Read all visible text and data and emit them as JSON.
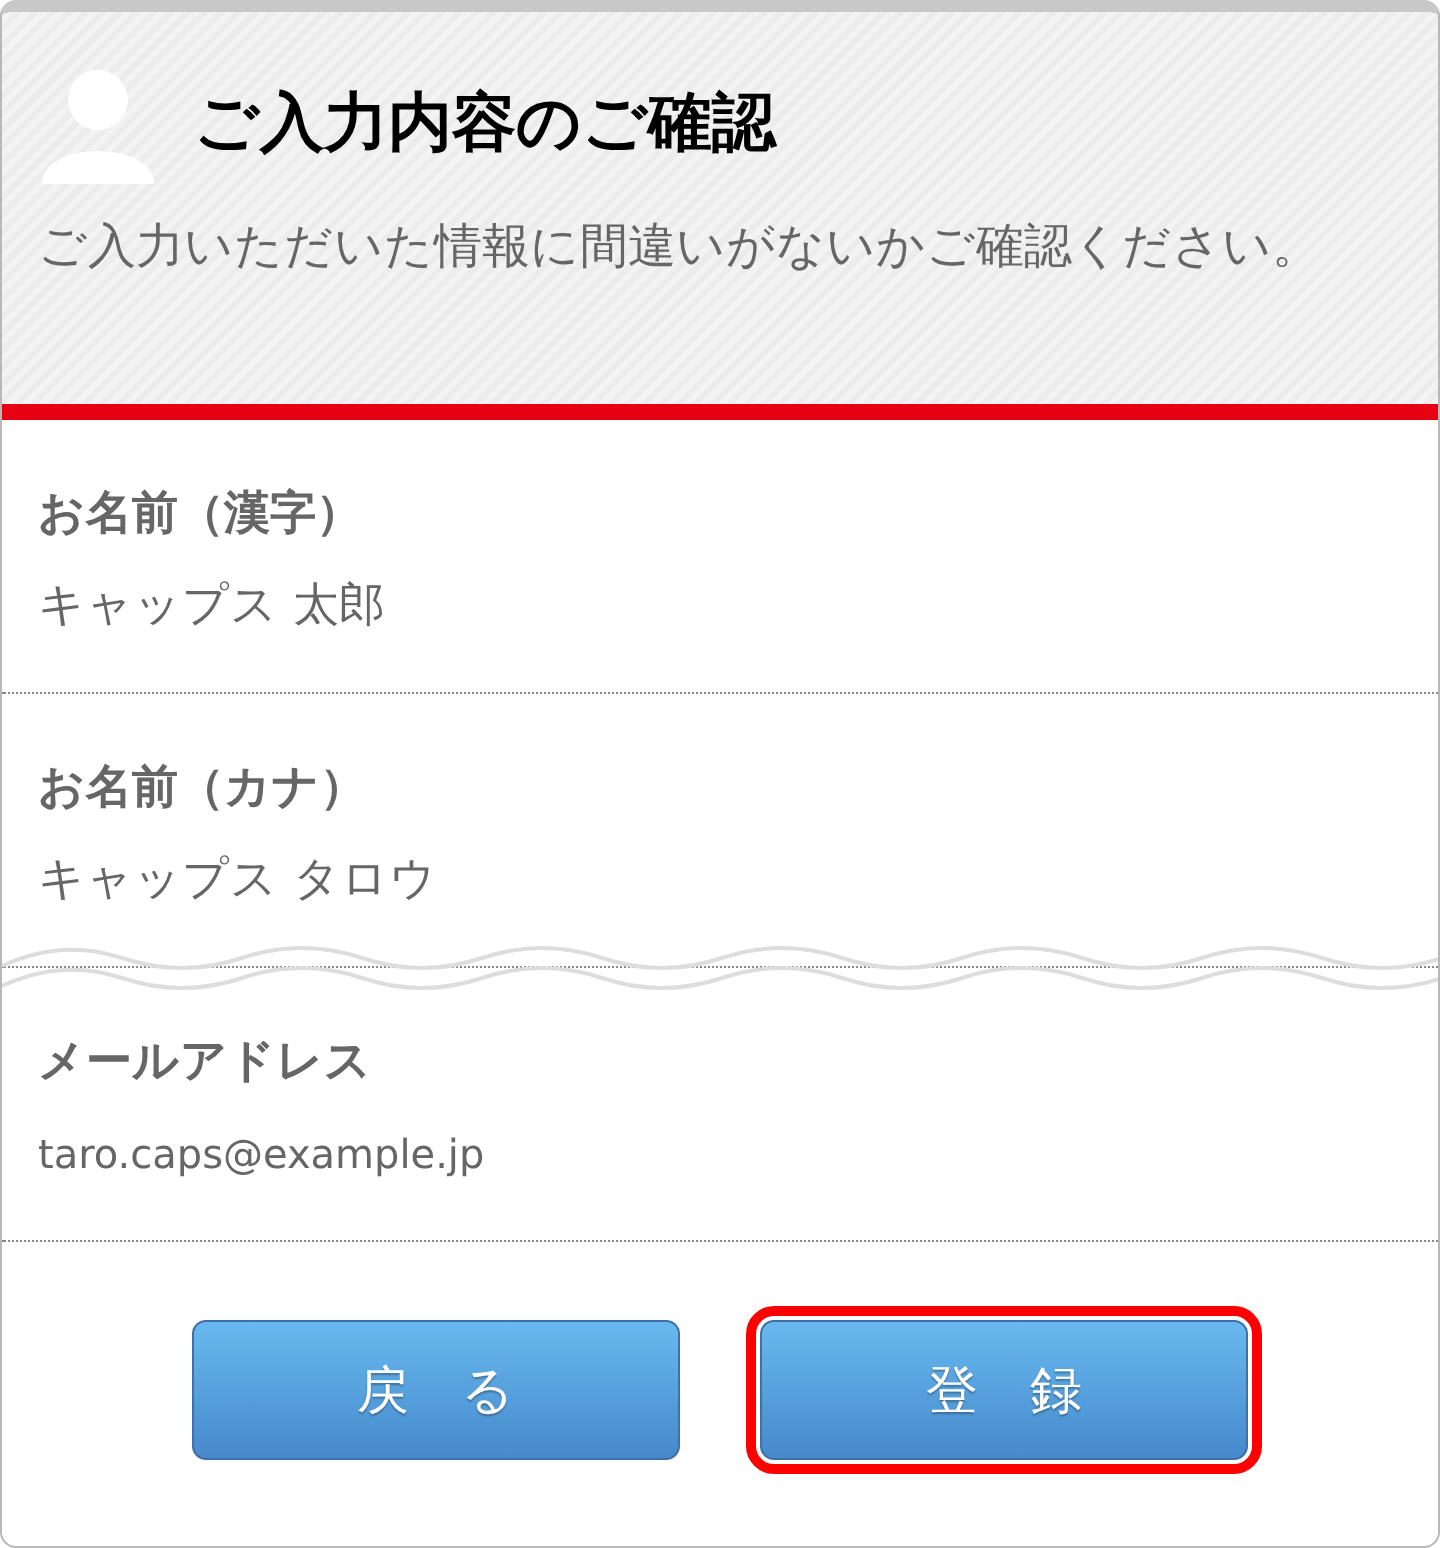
{
  "header": {
    "title": "ご入力内容のご確認",
    "description": "ご入力いただいた情報に間違いがないかご確認ください。"
  },
  "fields": [
    {
      "label": "お名前（漢字）",
      "value": "キャップス 太郎"
    },
    {
      "label": "お名前（カナ）",
      "value": "キャップス タロウ"
    },
    {
      "label": "メールアドレス",
      "value": "taro.caps@example.jp"
    }
  ],
  "buttons": [
    {
      "label": "戻　る",
      "selected": false
    },
    {
      "label": "登　録",
      "selected": true
    }
  ]
}
